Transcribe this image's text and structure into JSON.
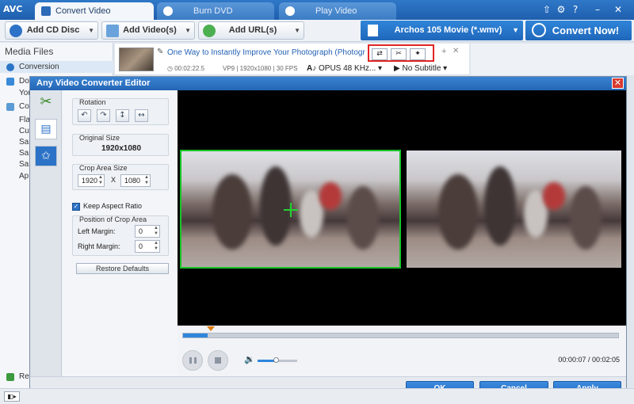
{
  "app": {
    "logo": "AVC",
    "tabs": [
      {
        "label": "Convert Video"
      },
      {
        "label": "Burn DVD"
      },
      {
        "label": "Play Video"
      }
    ],
    "window_controls": {
      "share": "⇧",
      "settings": "⚙",
      "help": "?",
      "minimize": "–",
      "close": "✕"
    }
  },
  "toolbar": {
    "add_cd": "Add CD Disc",
    "add_videos": "Add Video(s)",
    "add_url": "Add URL(s)",
    "format": "Archos 105 Movie (*.wmv)",
    "convert_now": "Convert Now!"
  },
  "sidebar": {
    "header": "Media Files",
    "items": [
      {
        "label": "Conversion"
      },
      {
        "label": "Do"
      },
      {
        "label": "You"
      },
      {
        "label": "Co"
      },
      {
        "label": "Fla"
      },
      {
        "label": "Cu"
      },
      {
        "label": "Sar"
      },
      {
        "label": "Sar"
      },
      {
        "label": "Sar"
      },
      {
        "label": "Ap"
      }
    ],
    "recycle": "Rec"
  },
  "file": {
    "title": "One Way to Instantly Improve Your Photograph (Photography...",
    "duration": "00:02:22.5",
    "codec": "VP9 | 1920x1080 | 30 FPS",
    "audio": "OPUS 48 KHz...",
    "subtitle": "No Subtitle"
  },
  "dialog": {
    "title": "Any Video Converter Editor",
    "close": "✕",
    "rotation_label": "Rotation",
    "original_size_label": "Original Size",
    "original_size": "1920x1080",
    "crop_area_label": "Crop Area Size",
    "crop_width": "1920",
    "crop_x": "X",
    "crop_height": "1080",
    "keep_aspect": "Keep Aspect Ratio",
    "position_label": "Position of Crop Area",
    "left_margin_label": "Left Margin:",
    "left_margin": "0",
    "right_margin_label": "Right Margin:",
    "right_margin": "0",
    "restore": "Restore Defaults",
    "time": "00:00:07 / 00:02:05",
    "playback_progress": 0.056,
    "volume_level": 0.45,
    "ok": "OK",
    "cancel": "Cancel",
    "apply": "Apply"
  },
  "colors": {
    "accent": "#1f67bb",
    "crop_border": "#18c42a",
    "highlight_box": "#e02424"
  }
}
